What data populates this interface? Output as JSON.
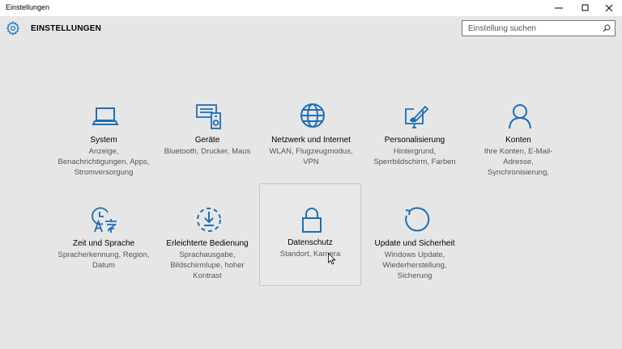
{
  "window": {
    "title": "Einstellungen",
    "minimize_icon": "minimize-icon",
    "maximize_icon": "maximize-icon",
    "close_icon": "close-icon"
  },
  "header": {
    "app_title": "EINSTELLUNGEN",
    "icon": "gear-icon"
  },
  "search": {
    "placeholder": "Einstellung suchen",
    "value": "",
    "icon": "search-icon"
  },
  "accent_color": "#1c6fb8",
  "tiles": [
    {
      "id": "system",
      "label": "System",
      "description": "Anzeige, Benachrichtigungen, Apps, Stromversorgung",
      "icon": "laptop-icon"
    },
    {
      "id": "devices",
      "label": "Geräte",
      "description": "Bluetooth, Drucker, Maus",
      "icon": "devices-icon"
    },
    {
      "id": "network",
      "label": "Netzwerk und Internet",
      "description": "WLAN, Flugzeugmodus, VPN",
      "icon": "globe-icon"
    },
    {
      "id": "personalization",
      "label": "Personalisierung",
      "description": "Hintergrund, Sperrbildschirm, Farben",
      "icon": "paint-icon"
    },
    {
      "id": "accounts",
      "label": "Konten",
      "description": "Ihre Konten, E-Mail-Adresse, Synchronisierung,",
      "icon": "person-icon"
    },
    {
      "id": "time-language",
      "label": "Zeit und Sprache",
      "description": "Spracherkennung, Region, Datum",
      "icon": "clock-language-icon"
    },
    {
      "id": "ease-of-access",
      "label": "Erleichterte Bedienung",
      "description": "Sprachausgabe, Bildschirmlupe, hoher Kontrast",
      "icon": "ease-of-access-icon"
    },
    {
      "id": "privacy",
      "label": "Datenschutz",
      "description": "Standort, Kamera",
      "icon": "lock-icon"
    },
    {
      "id": "update-security",
      "label": "Update und Sicherheit",
      "description": "Windows Update, Wiederherstellung, Sicherung",
      "icon": "refresh-icon"
    }
  ]
}
